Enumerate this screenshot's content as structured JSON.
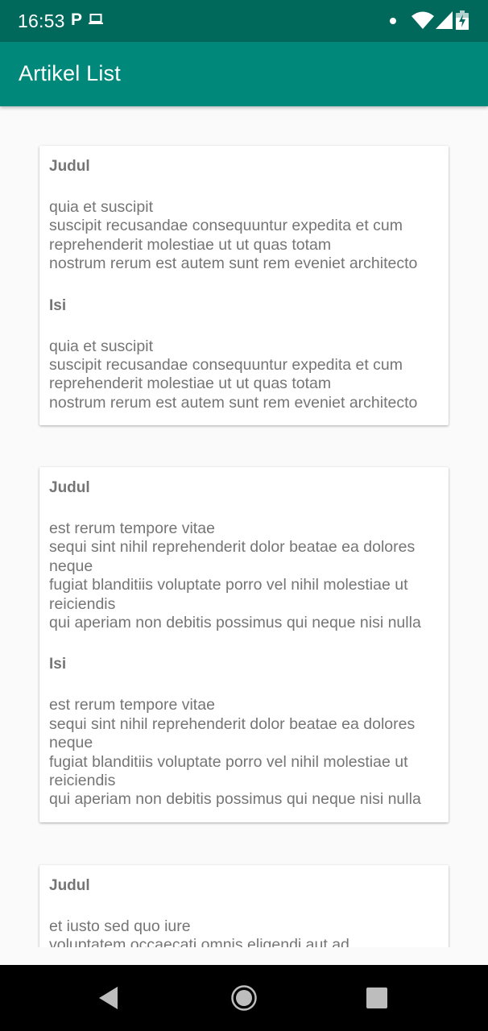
{
  "status_bar": {
    "time": "16:53",
    "p_indicator": "P",
    "icons": [
      "laptop-icon",
      "notification-dot-icon",
      "wifi-icon",
      "cell-signal-icon",
      "battery-charging-icon"
    ],
    "background_color": "#00695c"
  },
  "app_bar": {
    "title": "Artikel List",
    "background_color": "#00897b"
  },
  "articles": [
    {
      "judul_label": "Judul",
      "judul": "quia et suscipit\nsuscipit recusandae consequuntur expedita et cum\nreprehenderit molestiae ut ut quas totam\nnostrum rerum est autem sunt rem eveniet architecto",
      "isi_label": "Isi",
      "isi": "quia et suscipit\nsuscipit recusandae consequuntur expedita et cum\nreprehenderit molestiae ut ut quas totam\nnostrum rerum est autem sunt rem eveniet architecto"
    },
    {
      "judul_label": "Judul",
      "judul": "est rerum tempore vitae\nsequi sint nihil reprehenderit dolor beatae ea dolores\nneque\nfugiat blanditiis voluptate porro vel nihil molestiae ut\nreiciendis\nqui aperiam non debitis possimus qui neque nisi nulla",
      "isi_label": "Isi",
      "isi": "est rerum tempore vitae\nsequi sint nihil reprehenderit dolor beatae ea dolores\nneque\nfugiat blanditiis voluptate porro vel nihil molestiae ut\nreiciendis\nqui aperiam non debitis possimus qui neque nisi nulla"
    },
    {
      "judul_label": "Judul",
      "judul": "et iusto sed quo iure\nvoluptatem occaecati omnis eligendi aut ad"
    }
  ],
  "nav_bar": {
    "icons": [
      "back-icon",
      "home-icon",
      "recents-icon"
    ]
  }
}
